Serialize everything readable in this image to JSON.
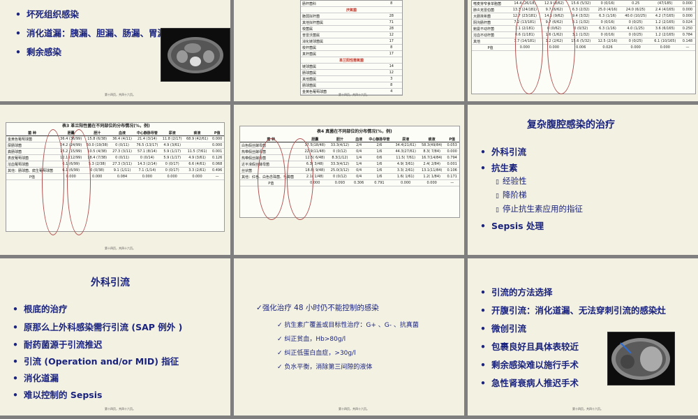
{
  "footer": "第十四页，共四十六页。",
  "s1": {
    "bullets": [
      "坏死组织感染",
      "消化道漏：胰漏、胆漏、肠漏、胃漏",
      "剩余感染"
    ]
  },
  "s2": {
    "rows_top": [
      [
        "肠杆菌科",
        "8"
      ]
    ],
    "sec1": "厌氧菌",
    "rows1": [
      [
        "脆弱拟杆菌",
        "28"
      ],
      [
        "其他拟杆菌属",
        "71"
      ],
      [
        "梭菌属",
        "28"
      ],
      [
        "普雷沃菌属",
        "12"
      ],
      [
        "消化链球菌属",
        "17"
      ],
      [
        "梭杆菌属",
        "8"
      ],
      [
        "真杆菌属",
        "17"
      ]
    ],
    "sec2": "革兰阳性需氧菌",
    "rows2": [
      [
        "链球菌属",
        "14"
      ],
      [
        "肠球菌属",
        "12"
      ],
      [
        "其他菌属",
        "3"
      ],
      [
        "肠球菌属",
        "8"
      ],
      [
        "金黄色葡萄球菌",
        "4"
      ]
    ]
  },
  "s3": {
    "rows": [
      [
        "嗜麦芽窄食单胞菌",
        "14.4 (26/18)",
        "12.9 (8/62)",
        "15.6 (5/32)",
        "0 (0/16)",
        "0.25",
        "(47/185)",
        "0.000"
      ],
      [
        "肺炎克雷伯菌",
        "13.3 (24/181)",
        "9.7 (6/62)",
        "6.3 (2/32)",
        "25.0 (4/16)",
        "24.0 (6/25)",
        "2.4 (4/165)",
        "0.000"
      ],
      [
        "大肠埃希菌",
        "12.7 (23/181)",
        "14.5 (9/62)",
        "9.4 (3/32)",
        "6.3 (1/16)",
        "40.0 (10/25)",
        "4.2 (7/165)",
        "0.000"
      ],
      [
        "阴沟肠杆菌",
        "7.2 (13/181)",
        "9.7 (6/62)",
        "3.1 (1/32)",
        "0 (0/16)",
        "0 (0/25)",
        "1.2 (2/165)",
        "0.024"
      ],
      [
        "鲍曼不动杆菌",
        "1.1 (2/181)",
        "0 (0/62)",
        "0 (0/32)",
        "6.3 (1/16)",
        "4.0 (1/25)",
        "3.6 (6/165)",
        "0.250"
      ],
      [
        "溶血不动杆菌",
        "0.6 (1/181)",
        "1.6 (1/62)",
        "3.1 (1/32)",
        "0 (0/16)",
        "0 (0/25)",
        "1.2 (2/165)",
        "0.784"
      ],
      [
        "其他",
        "7.7 (14/181)",
        "3.2 (2/62)",
        "15.6 (5/32)",
        "12.5 (2/16)",
        "0 (0/25)",
        "6.1 (10/165)",
        "0.148"
      ]
    ],
    "p": [
      "P值",
      "0.000",
      "0.000",
      "0.006",
      "0.026",
      "0.000",
      "0.000",
      "—"
    ]
  },
  "s4": {
    "caption": "表3  革兰阳性菌在不同部位的分布情况(%，例)",
    "header": [
      "菌  种",
      "胆囊",
      "胆汁",
      "血液",
      "中心静脉导管",
      "尿液",
      "痰液",
      "P值"
    ],
    "rows": [
      [
        "金黄色葡萄球菌",
        "36.4 (36/99)",
        "15.8 (6/38)",
        "36.4 (4/11)",
        "21.4 (3/14)",
        "11.8 (2/17)",
        "68.9 (42/61)",
        "0.000"
      ],
      [
        "屎肠球菌",
        "24.2 (24/99)",
        "50.0 (19/38)",
        "0 (0/11)",
        "76.5 (13/17)",
        "4.9 (3/61)",
        "",
        "0.000"
      ],
      [
        "粪肠球菌",
        "15.2 (15/99)",
        "10.5 (4/38)",
        "27.3 (3/11)",
        "57.1 (8/14)",
        "5.9 (1/17)",
        "11.5 (7/61)",
        "0.001"
      ],
      [
        "表皮葡萄球菌",
        "12.1 (12/99)",
        "18.4 (7/38)",
        "0 (0/11)",
        "0 (0/14)",
        "5.9 (1/17)",
        "4.9 (3/61)",
        "0.126"
      ],
      [
        "溶血葡萄球菌",
        "6.1 (6/99)",
        "5.3 (2/38)",
        "27.3 (3/11)",
        "14.3 (2/14)",
        "0 (0/17)",
        "6.6 (4/61)",
        "0.068"
      ],
      [
        "其他：肠球菌、腐生葡萄球菌",
        "6.1 (6/99)",
        "0 (0/38)",
        "9.1 (1/11)",
        "7.1 (1/14)",
        "0 (0/17)",
        "3.3 (2/61)",
        "0.496"
      ]
    ],
    "p": [
      "P值",
      "0.000",
      "0.000",
      "0.084",
      "0.000",
      "0.000",
      "0.000",
      "—"
    ]
  },
  "s5": {
    "caption": "表4  真菌在不同部位的分布情况(%，例)",
    "header": [
      "菌  种",
      "胆囊",
      "胆汁",
      "血液",
      "中心静脉导管",
      "尿液",
      "痰液",
      "P值"
    ],
    "rows": [
      [
        "白色假丝酵母菌",
        "37.5(18/48)",
        "33.3(4/12)",
        "2/4",
        "2/6",
        "34.4(21/61)",
        "58.3(49/84)",
        "0.053"
      ],
      [
        "热带假丝酵母菌",
        "22.9(11/48)",
        "0 (0/12)",
        "0/4",
        "1/6",
        "44.3(27/61)",
        "8.3( 7/84)",
        "0.000"
      ],
      [
        "热带假丝酵母菌",
        "12.5( 6/48)",
        "8.3(1/12)",
        "1/4",
        "0/6",
        "11.5( 7/61)",
        "16.7(14/84)",
        "0.794"
      ],
      [
        "近平滑假丝酵母菌",
        "6.3( 3/48)",
        "33.3(4/12)",
        "1/4",
        "1/6",
        "4.9( 3/61)",
        "2.4( 2/84)",
        "0.001"
      ],
      [
        "丝状菌",
        "18.8( 9/48)",
        "25.0(3/12)",
        "0/4",
        "1/6",
        "3.3( 2/61)",
        "13.1(11/84)",
        "0.106"
      ],
      [
        "其他：红色、白色念珠菌、毛霉菌",
        "2.1( 1/48)",
        "0 (0/12)",
        "0/4",
        "1/6",
        "1.6( 1/61)",
        "1.2( 1/84)",
        "0.171"
      ]
    ],
    "p": [
      "P值",
      "0.000",
      "0.093",
      "0.306",
      "0.791",
      "0.000",
      "0.000",
      "—"
    ]
  },
  "s6": {
    "title": "复杂腹腔感染的治疗",
    "bullets": [
      "外科引流",
      "抗生素",
      "Sepsis 处理"
    ],
    "subs": [
      "经验性",
      "降阶梯",
      "停止抗生素应用的指征"
    ]
  },
  "s7": {
    "title": "外科引流",
    "bullets": [
      "根底的治疗",
      "原那么上外科感染需行引流 (SAP 例外 )",
      "耐药菌源于引流推迟",
      "引流 (Operation and/or MID) 指征",
      "消化道漏",
      "难以控制的 Sepsis"
    ]
  },
  "s8": {
    "main": "强化治疗 48 小时仍不能控制的感染",
    "items": [
      "抗生素广覆盖或目标性治疗：G+ 、G- 、抗真菌",
      "纠正贫血，Hb>80g/l",
      "纠正低蛋白血症，>30g/l",
      "负水平衡，消除第三间隙的液体"
    ]
  },
  "s9": {
    "bullets": [
      "引流的方法选择",
      "开腹引流：消化道漏、无法穿刺引流的感染灶",
      "微创引流",
      "包裹良好且具体表较近",
      "剩余感染难以施行手术",
      "急性肾衰病人推迟手术"
    ]
  }
}
